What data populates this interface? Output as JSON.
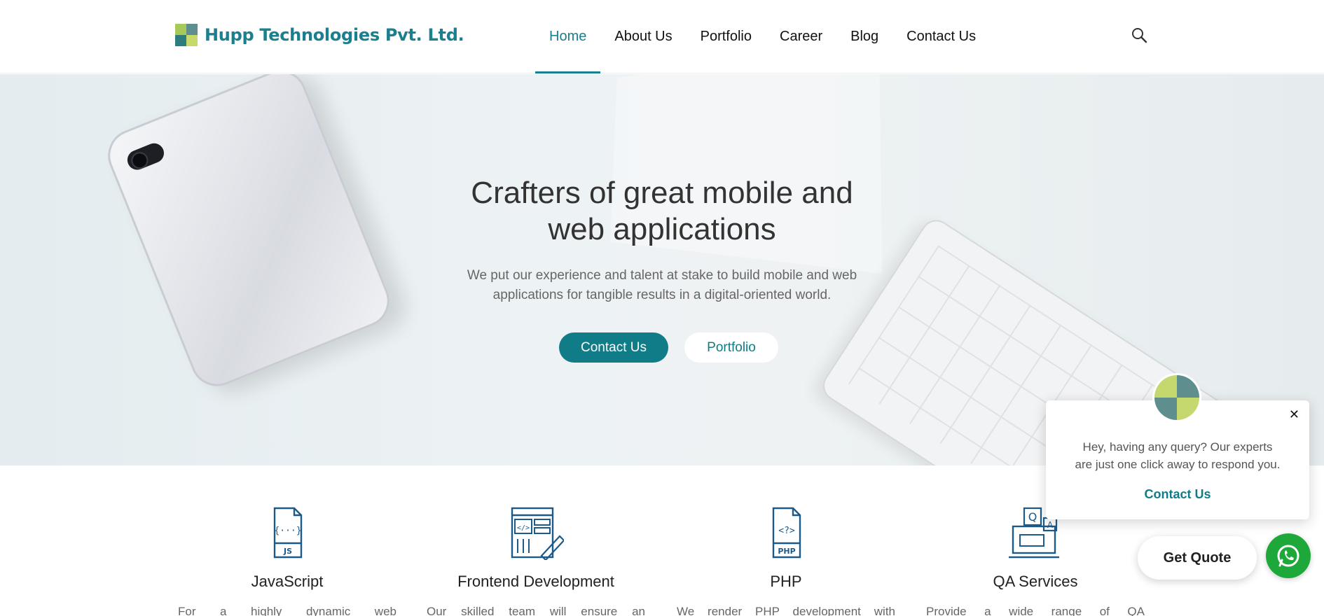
{
  "brand": {
    "name": "Hupp Technologies Pvt. Ltd.",
    "accent": "#0f7c87"
  },
  "nav": {
    "items": [
      {
        "label": "Home",
        "active": true
      },
      {
        "label": "About Us",
        "active": false
      },
      {
        "label": "Portfolio",
        "active": false
      },
      {
        "label": "Career",
        "active": false
      },
      {
        "label": "Blog",
        "active": false
      },
      {
        "label": "Contact Us",
        "active": false
      }
    ],
    "search_icon": "search-icon"
  },
  "hero": {
    "title_line1": "Crafters of great mobile and",
    "title_line2": "web applications",
    "subtitle_line1": "We put our experience and talent at stake to build mobile and web",
    "subtitle_line2": "applications for tangible results in a digital-oriented world.",
    "primary_button": "Contact Us",
    "secondary_button": "Portfolio"
  },
  "services": [
    {
      "title": "JavaScript",
      "text": "For a highly dynamic web",
      "icon": "javascript-file-icon"
    },
    {
      "title": "Frontend Development",
      "text": "Our skilled team will ensure an",
      "icon": "code-editor-icon"
    },
    {
      "title": "PHP",
      "text": "We render PHP development with",
      "icon": "php-file-icon"
    },
    {
      "title": "QA Services",
      "text": "Provide a wide range of QA",
      "icon": "qa-laptop-icon"
    }
  ],
  "chat": {
    "message_line1": "Hey, having any query? Our experts",
    "message_line2": "are just one click away to respond you.",
    "link": "Contact Us",
    "close": "✕"
  },
  "floating": {
    "get_quote": "Get Quote",
    "whatsapp_icon": "whatsapp-icon",
    "whatsapp_color": "#1fa83a"
  }
}
